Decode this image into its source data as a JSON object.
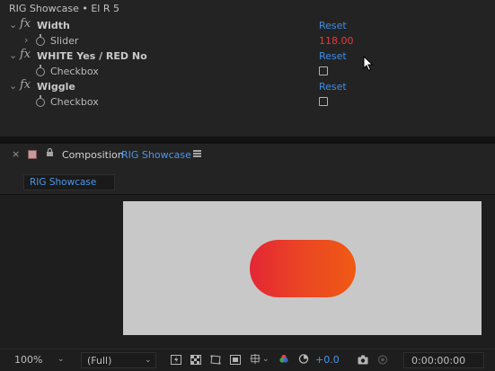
{
  "effect_controls": {
    "title": "RIG Showcase • El R 5",
    "effects": [
      {
        "name": "Width",
        "reset_label": "Reset",
        "property": {
          "label": "Slider",
          "value": "118.00"
        }
      },
      {
        "name": "WHITE Yes / RED No",
        "reset_label": "Reset",
        "property": {
          "label": "Checkbox",
          "checked": false
        }
      },
      {
        "name": "Wiggle",
        "reset_label": "Reset",
        "property": {
          "label": "Checkbox",
          "checked": false
        }
      }
    ]
  },
  "composition_panel": {
    "prefix": "Composition",
    "name": "RIG Showcase",
    "tab_label": "RIG Showcase",
    "label_color": "#c99a99",
    "pill_gradient": [
      "#e42635",
      "#f05a14"
    ]
  },
  "viewer_toolbar": {
    "zoom": "100%",
    "resolution": "(Full)",
    "exposure": "+0.0",
    "timecode": "0:00:00:00"
  },
  "icons": {
    "fx": "fx-icon",
    "stopwatch": "stopwatch-icon",
    "close": "close-icon",
    "lock": "lock-icon",
    "menu": "hamburger-menu-icon"
  }
}
